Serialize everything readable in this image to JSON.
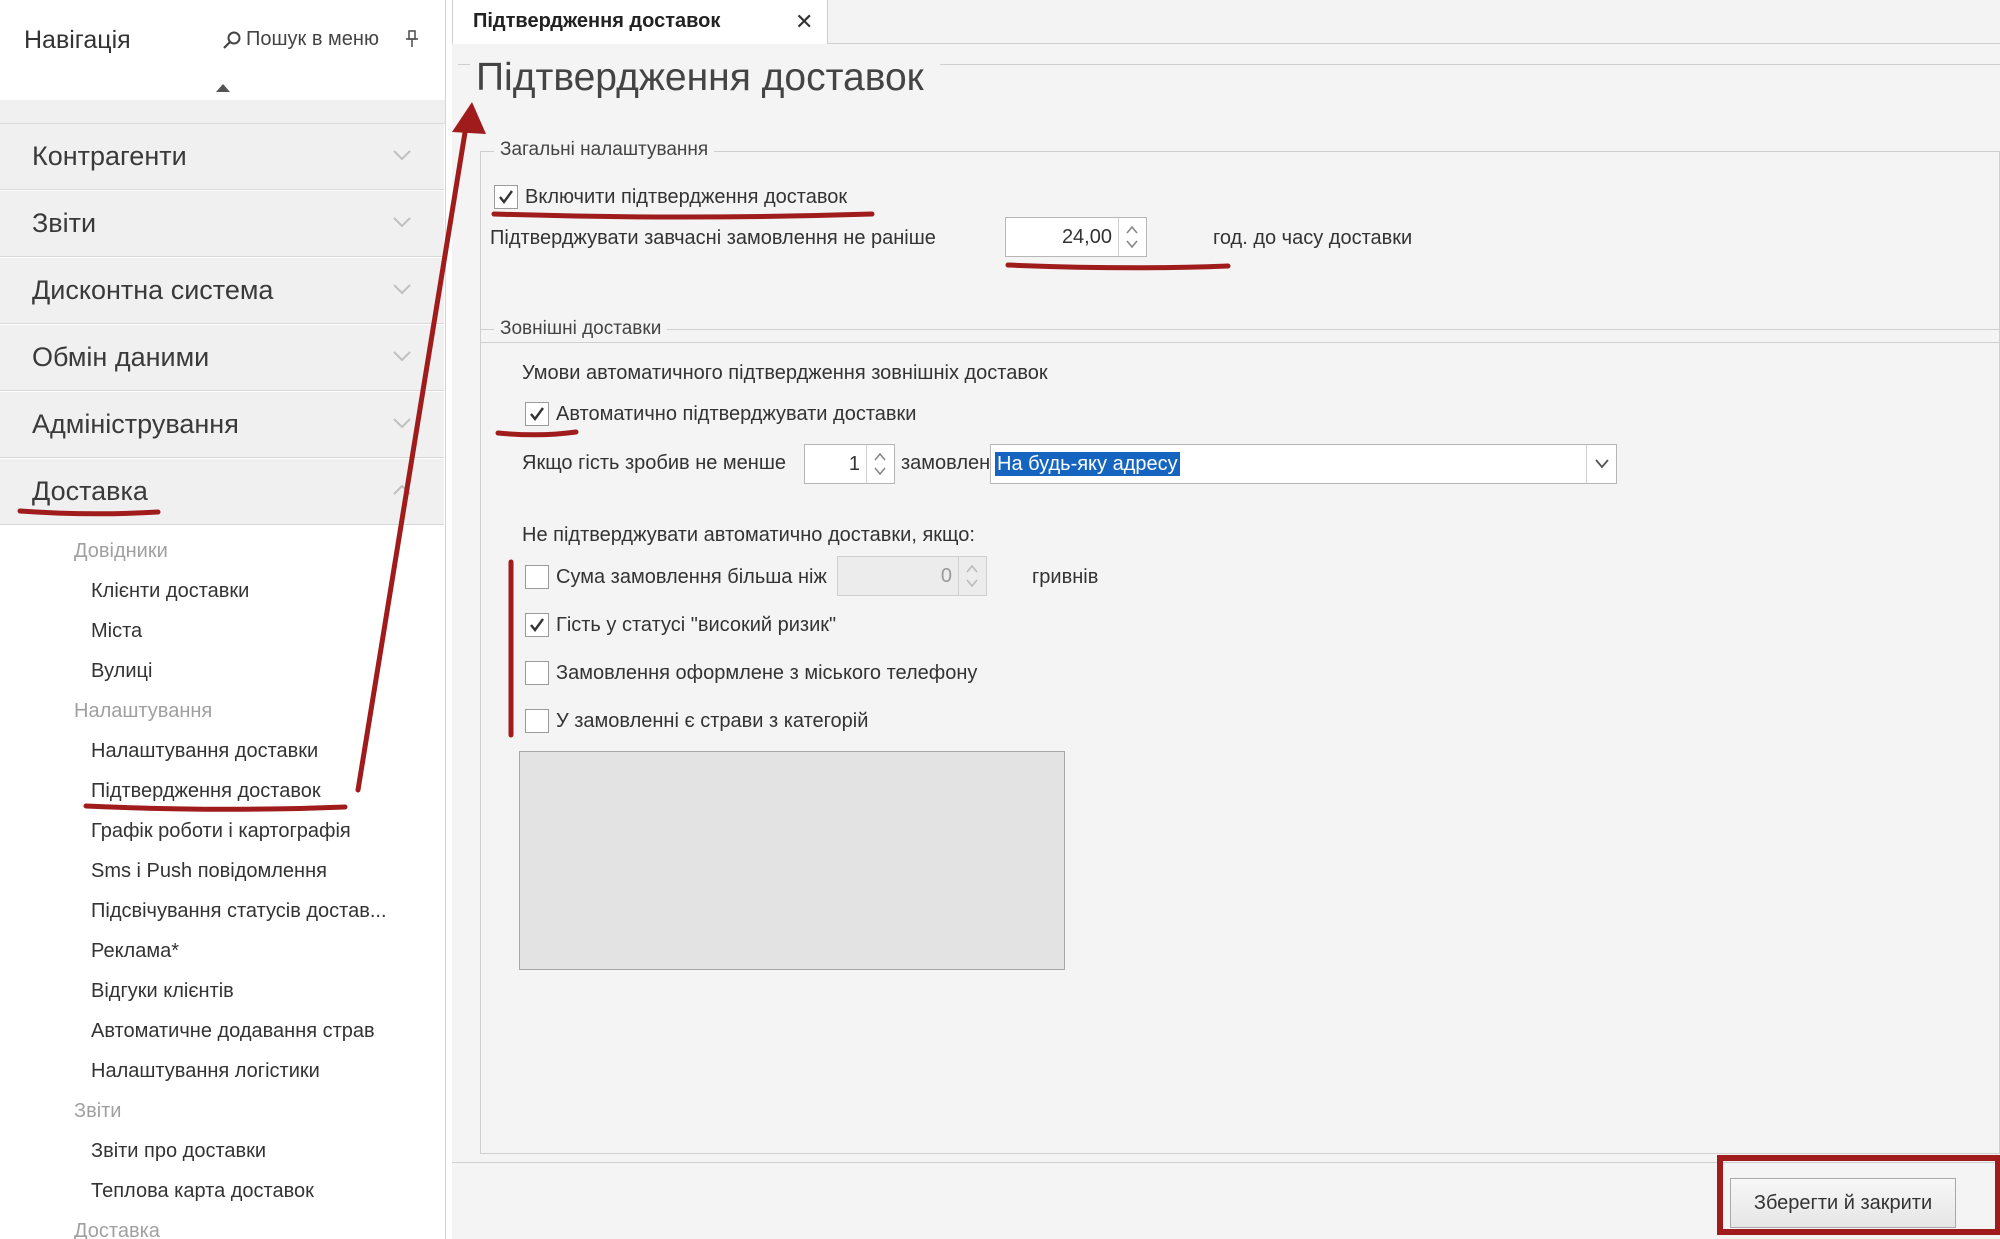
{
  "sidebar": {
    "title": "Навігація",
    "search_label": "Пошук в меню",
    "groups": [
      {
        "label": "Контрагенти"
      },
      {
        "label": "Звіти"
      },
      {
        "label": "Дисконтна система"
      },
      {
        "label": "Обмін даними"
      },
      {
        "label": "Адміністрування"
      },
      {
        "label": "Доставка"
      }
    ],
    "delivery_menu": {
      "cat_reference": "Довідники",
      "delivery_clients": "Клієнти доставки",
      "cities": "Міста",
      "streets": "Вулиці",
      "cat_settings": "Налаштування",
      "delivery_settings": "Налаштування доставки",
      "delivery_confirmation": "Підтвердження доставок",
      "schedule_mapping": "Графік роботи і картографія",
      "sms_push": "Sms і Push повідомлення",
      "status_highlight": "Підсвічування статусів достав...",
      "advertising": "Реклама*",
      "customer_reviews": "Відгуки клієнтів",
      "auto_add_dishes": "Автоматичне додавання страв",
      "logistics_settings": "Налаштування логістики",
      "cat_reports": "Звіти",
      "delivery_reports": "Звіти про доставки",
      "heat_map": "Теплова карта доставок",
      "cat_delivery": "Доставка"
    }
  },
  "tab": {
    "label": "Підтвердження доставок",
    "close": "✕"
  },
  "page": {
    "title": "Підтвердження доставок",
    "general": {
      "legend": "Загальні налаштування",
      "enable_label": "Включити підтвердження доставок",
      "enable_checked": true,
      "early_label": "Підтверджувати завчасні замовлення не раніше",
      "early_value": "24,00",
      "early_suffix": "год. до часу доставки"
    },
    "external": {
      "legend": "Зовнішні доставки",
      "conditions_label": "Умови автоматичного підтвердження зовнішніх доставок",
      "auto_label": "Автоматично підтверджувати доставки",
      "auto_checked": true,
      "min_orders_label": "Якщо гість зробив не менше",
      "min_orders_value": "1",
      "orders_label": "замовлен",
      "address_value": "На будь-яку адресу",
      "no_auto_label": "Не підтверджувати автоматично доставки, якщо:",
      "rules": [
        {
          "label": "Сума замовлення більша ніж",
          "checked": false
        },
        {
          "label": "Гість у статусі \"високий ризик\"",
          "checked": true
        },
        {
          "label": "Замовлення оформлене з міського телефону",
          "checked": false
        },
        {
          "label": "У замовленні є страви з категорій",
          "checked": false
        }
      ],
      "sum_value": "0",
      "currency": "гривнів"
    },
    "save_label": "Зберегти й закрити"
  },
  "colors": {
    "annotation": "#a01c1c",
    "selection": "#1565c0"
  }
}
